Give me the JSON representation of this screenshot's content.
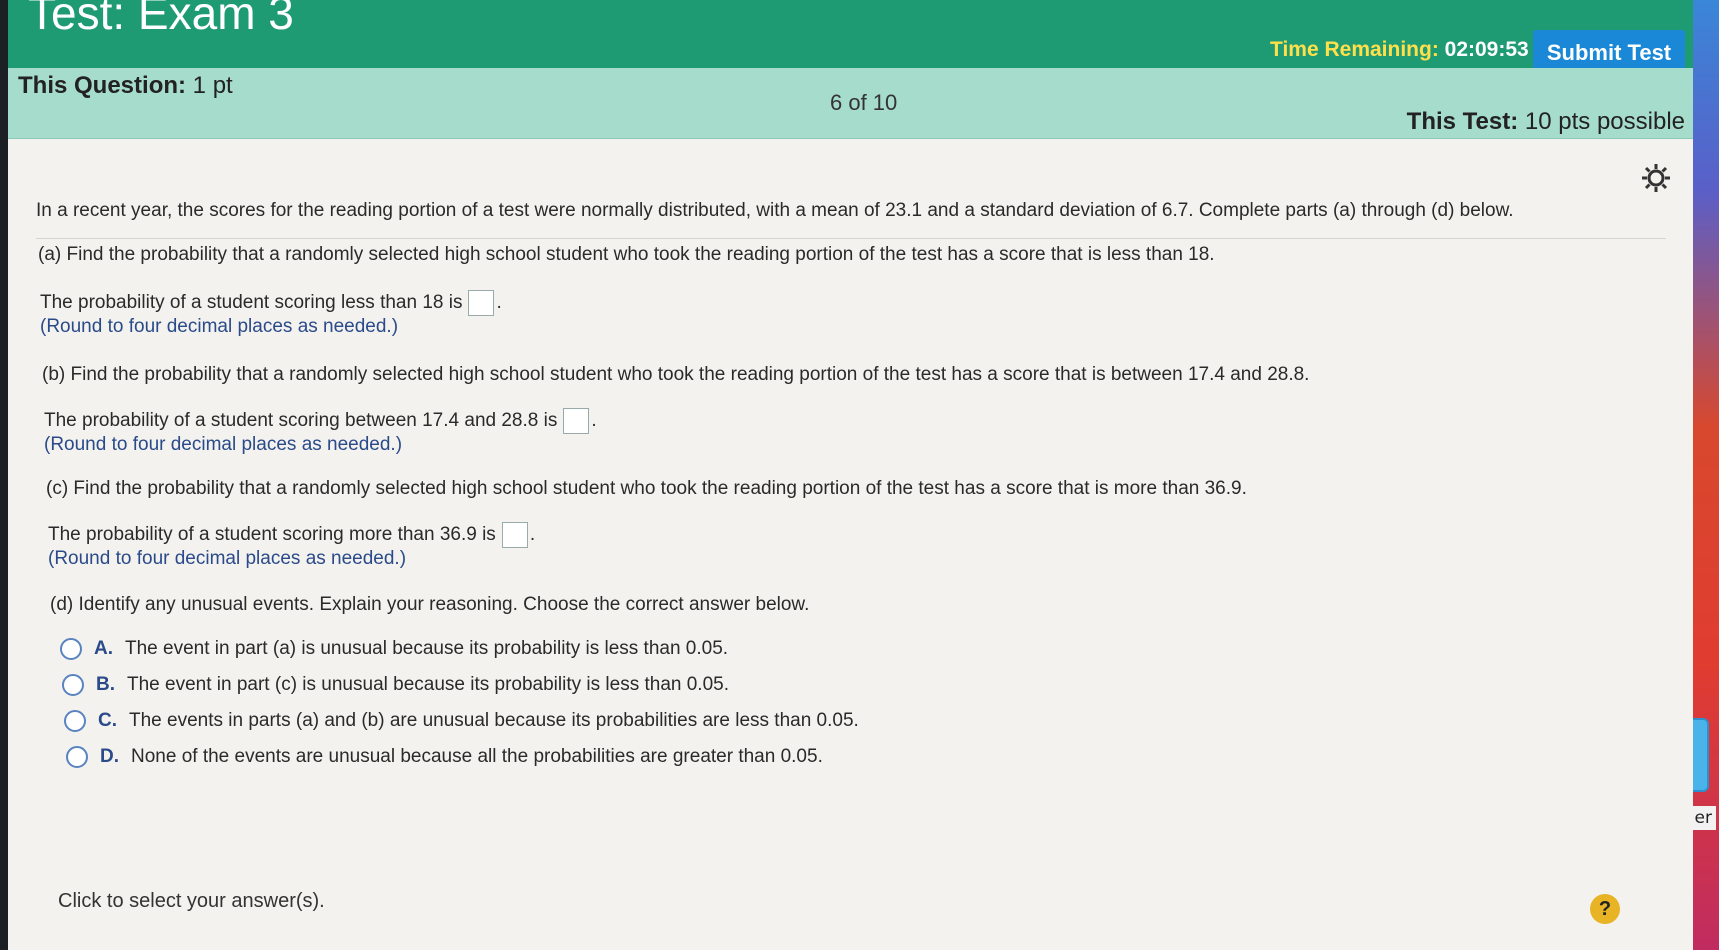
{
  "header": {
    "title": "Test: Exam 3",
    "time_label": "Time Remaining:",
    "time_value": "02:09:53",
    "submit_label": "Submit Test"
  },
  "info": {
    "question_label": "This Question:",
    "question_points": "1 pt",
    "question_count": "6 of 10",
    "test_label": "This Test:",
    "test_points": "10 pts possible"
  },
  "question": {
    "intro": "In a recent year, the scores for the reading portion of a test were normally distributed, with a mean of 23.1 and a standard deviation of 6.7. Complete parts (a) through (d) below.",
    "part_a": "(a) Find the probability that a randomly selected high school student who took the reading portion of the test has a score that is less than 18.",
    "answer_a": "The probability of a student scoring less than 18 is",
    "hint_a": "(Round to four decimal places as needed.)",
    "part_b": "(b) Find the probability that a randomly selected high school student who took the reading portion of the test has a score that is between 17.4 and 28.8.",
    "answer_b": "The probability of a student scoring between 17.4 and 28.8 is",
    "hint_b": "(Round to four decimal places as needed.)",
    "part_c": "(c) Find the probability that a randomly selected high school student who took the reading portion of the test has a score that is more than 36.9.",
    "answer_c": "The probability of a student scoring more than 36.9 is",
    "hint_c": "(Round to four decimal places as needed.)",
    "part_d": "(d) Identify any unusual events. Explain your reasoning. Choose the correct answer below.",
    "options": [
      {
        "letter": "A.",
        "text": "The event in part (a) is unusual because its probability is less than 0.05."
      },
      {
        "letter": "B.",
        "text": "The event in part (c) is unusual because its probability is less than 0.05."
      },
      {
        "letter": "C.",
        "text": "The events in parts (a) and (b) are unusual because its probabilities are less than 0.05."
      },
      {
        "letter": "D.",
        "text": "None of the events are unusual because all the probabilities are greater than 0.05."
      }
    ]
  },
  "footer": {
    "click_hint": "Click to select your answer(s).",
    "help_label": "?"
  },
  "desktop": {
    "folder_label": "ed folder"
  },
  "icons": {
    "settings": "gear-icon",
    "help": "help-icon",
    "folder": "folder-icon"
  },
  "colors": {
    "header_green": "#1f9b74",
    "info_bar": "#a6dccb",
    "submit_blue": "#1a88d6",
    "time_yellow": "#ffe04a"
  }
}
